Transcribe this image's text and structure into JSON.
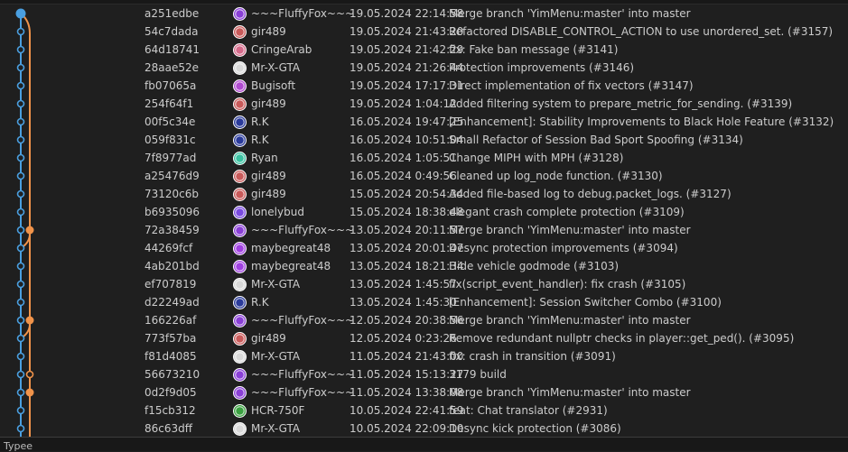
{
  "bottom_panel": {
    "label": "Typee"
  },
  "colors": {
    "main_lane": "#4a9fe0",
    "merge_lane": "#f0934a",
    "background": "#1f1f1f"
  },
  "commits": [
    {
      "hash": "a251edbe",
      "author": "~~~FluffyFox~~~",
      "date": "19.05.2024 22:14:58",
      "message": "Merge branch 'YimMenu:master' into master",
      "avatar_color": "#8a3fd6"
    },
    {
      "hash": "54c7dada",
      "author": "gir489",
      "date": "19.05.2024 21:43:20",
      "message": "Refactored DISABLE_CONTROL_ACTION to use unordered_set. (#3157)",
      "avatar_color": "#c85a5a"
    },
    {
      "hash": "64d18741",
      "author": "CringeArab",
      "date": "19.05.2024 21:42:29",
      "message": "fix: Fake ban message (#3141)",
      "avatar_color": "#d46a8a"
    },
    {
      "hash": "28aae52e",
      "author": "Mr-X-GTA",
      "date": "19.05.2024 21:26:44",
      "message": "Protection improvements (#3146)",
      "avatar_color": "#d8d8d8"
    },
    {
      "hash": "fb07065a",
      "author": "Bugisoft",
      "date": "19.05.2024 17:17:31",
      "message": "Direct implementation of fix vectors (#3147)",
      "avatar_color": "#b04ad0"
    },
    {
      "hash": "254f64f1",
      "author": "gir489",
      "date": "19.05.2024 1:04:12",
      "message": "Added filtering system to prepare_metric_for_sending. (#3139)",
      "avatar_color": "#c85a5a"
    },
    {
      "hash": "00f5c34e",
      "author": "R.K",
      "date": "16.05.2024 19:47:25",
      "message": "[Enhancement]: Stability Improvements to Black Hole Feature (#3132)",
      "avatar_color": "#2a3a9a"
    },
    {
      "hash": "059f831c",
      "author": "R.K",
      "date": "16.05.2024 10:51:04",
      "message": "Small Refactor of Session Bad Sport Spoofing (#3134)",
      "avatar_color": "#2a3a9a"
    },
    {
      "hash": "7f8977ad",
      "author": "Ryan",
      "date": "16.05.2024 1:05:51",
      "message": "Change MIPH with MPH (#3128)",
      "avatar_color": "#3ac0a0"
    },
    {
      "hash": "a25476d9",
      "author": "gir489",
      "date": "16.05.2024 0:49:56",
      "message": "Cleaned up log_node function. (#3130)",
      "avatar_color": "#c85a5a"
    },
    {
      "hash": "73120c6b",
      "author": "gir489",
      "date": "15.05.2024 20:54:34",
      "message": "Added file-based log to debug.packet_logs. (#3127)",
      "avatar_color": "#c85a5a"
    },
    {
      "hash": "b6935096",
      "author": "lonelybud",
      "date": "15.05.2024 18:38:48",
      "message": "elegant crash complete protection (#3109)",
      "avatar_color": "#7a4ae0"
    },
    {
      "hash": "72a38459",
      "author": "~~~FluffyFox~~~",
      "date": "13.05.2024 20:11:57",
      "message": "Merge branch 'YimMenu:master' into master",
      "avatar_color": "#8a3fd6"
    },
    {
      "hash": "44269fcf",
      "author": "maybegreat48",
      "date": "13.05.2024 20:01:47",
      "message": "Desync protection improvements (#3094)",
      "avatar_color": "#a040e0"
    },
    {
      "hash": "4ab201bd",
      "author": "maybegreat48",
      "date": "13.05.2024 18:21:34",
      "message": "Hide vehicle godmode (#3103)",
      "avatar_color": "#a040e0"
    },
    {
      "hash": "ef707819",
      "author": "Mr-X-GTA",
      "date": "13.05.2024 1:45:57",
      "message": "fix(script_event_handler): fix crash (#3105)",
      "avatar_color": "#d8d8d8"
    },
    {
      "hash": "d22249ad",
      "author": "R.K",
      "date": "13.05.2024 1:45:30",
      "message": "[Enhancement]: Session Switcher Combo (#3100)",
      "avatar_color": "#2a3a9a"
    },
    {
      "hash": "166226af",
      "author": "~~~FluffyFox~~~",
      "date": "12.05.2024 20:38:56",
      "message": "Merge branch 'YimMenu:master' into master",
      "avatar_color": "#8a3fd6"
    },
    {
      "hash": "773f57ba",
      "author": "gir489",
      "date": "12.05.2024 0:23:26",
      "message": "Remove redundant nullptr checks in player::get_ped(). (#3095)",
      "avatar_color": "#c85a5a"
    },
    {
      "hash": "f81d4085",
      "author": "Mr-X-GTA",
      "date": "11.05.2024 21:43:00",
      "message": "fix: crash in transition (#3091)",
      "avatar_color": "#d8d8d8"
    },
    {
      "hash": "56673210",
      "author": "~~~FluffyFox~~~",
      "date": "11.05.2024 15:13:27",
      "message": "3179 build",
      "avatar_color": "#8a3fd6"
    },
    {
      "hash": "0d2f9d05",
      "author": "~~~FluffyFox~~~",
      "date": "11.05.2024 13:38:08",
      "message": "Merge branch 'YimMenu:master' into master",
      "avatar_color": "#8a3fd6"
    },
    {
      "hash": "f15cb312",
      "author": "HCR-750F",
      "date": "10.05.2024 22:41:59",
      "message": "feat: Chat translator (#2931)",
      "avatar_color": "#3aa040"
    },
    {
      "hash": "86c63dff",
      "author": "Mr-X-GTA",
      "date": "10.05.2024 22:09:10",
      "message": "Desync kick protection (#3086)",
      "avatar_color": "#d8d8d8"
    }
  ]
}
